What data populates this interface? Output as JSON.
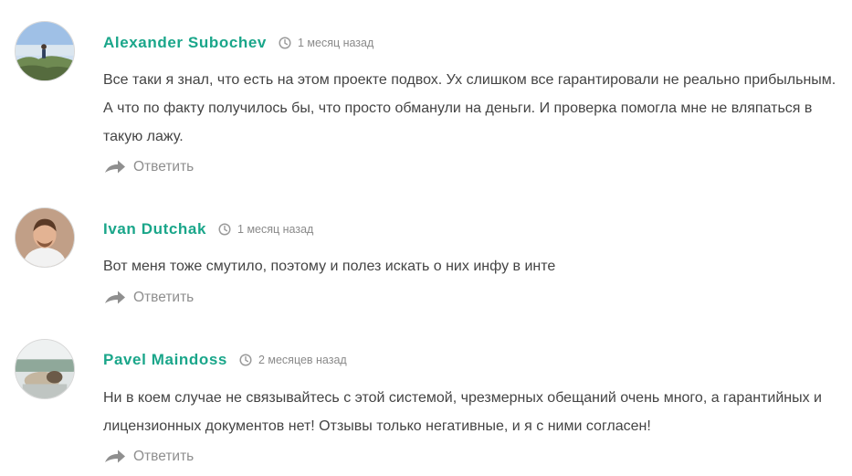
{
  "comments": [
    {
      "author": "Alexander Subochev",
      "time": "1 месяц назад",
      "text": "Все таки я знал, что есть на этом проекте подвох. Ух слишком все гарантировали не реально прибыльным. А что по факту получилось бы, что просто обманули на деньги. И проверка помогла мне не вляпаться в такую лажу.",
      "reply_label": "Ответить"
    },
    {
      "author": "Ivan Dutchak",
      "time": "1 месяц назад",
      "text": "Вот меня тоже смутило, поэтому и полез искать о них инфу в инте",
      "reply_label": "Ответить"
    },
    {
      "author": "Pavel Maindoss",
      "time": "2 месяцев назад",
      "text": "Ни в коем случае не связывайтесь с этой системой, чрезмерных обещаний очень много, а гарантийных и лицензионных документов нет! Отзывы только негативные, и я с ними согласен!",
      "reply_label": "Ответить"
    }
  ],
  "colors": {
    "author": "#1aa68a",
    "text": "#444444",
    "meta": "#8a8a8a",
    "reply": "#8e8e8e"
  },
  "icons": {
    "time": "clock-icon",
    "reply": "reply-arrow-icon"
  }
}
